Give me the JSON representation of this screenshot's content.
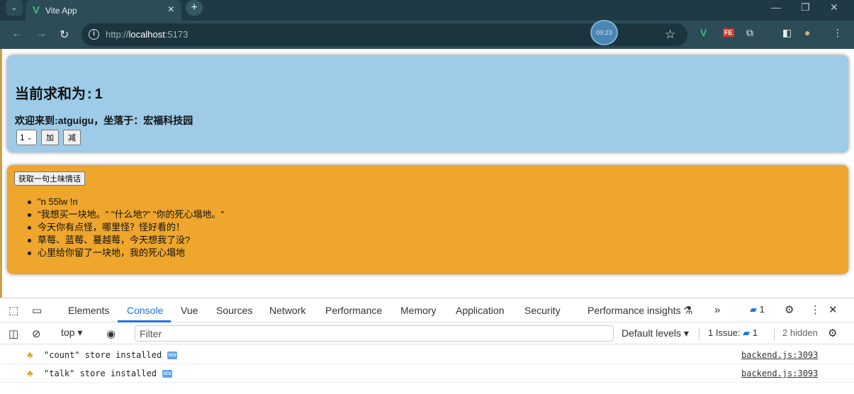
{
  "browser": {
    "tab_title": "Vite App",
    "url_scheme_host": "http://",
    "url_host": "localhost",
    "url_port": ":5173",
    "timer": "09:23"
  },
  "count_card": {
    "sum_label": "当前求和为",
    "sum_colon": ":",
    "sum_value": "1",
    "school_text": "欢迎来到:atguigu，坐落于：宏福科技园",
    "step_selected": "1",
    "add_label": "加",
    "minus_label": "减"
  },
  "talk_card": {
    "fetch_label": "获取一句土味情话",
    "items": [
      "\"n 55lw !n",
      "\"我想买一块地。\"  \"什么地?\"  \"你的死心塌地。\"",
      "今天你有点怪，哪里怪？怪好看的！",
      "草莓、蓝莓、蔓越莓，今天想我了没?",
      "心里给你留了一块地，我的死心塌地"
    ]
  },
  "devtools": {
    "tabs": [
      "Elements",
      "Console",
      "Vue",
      "Sources",
      "Network",
      "Performance",
      "Memory",
      "Application",
      "Security",
      "Performance insights"
    ],
    "active_tab": "Console",
    "context": "top",
    "filter_placeholder": "Filter",
    "levels": "Default levels",
    "issues_label": "1 Issue:",
    "issues_count": "1",
    "hidden": "2 hidden",
    "message_badge_count": "1",
    "logs": [
      {
        "text": "\"count\" store installed",
        "source": "backend.js:3093"
      },
      {
        "text": "\"talk\" store installed",
        "source": "backend.js:3093"
      }
    ]
  },
  "colors": {
    "count_card_bg": "#9dcbe8",
    "talk_card_bg": "#eea62c",
    "accent": "#1a73e8"
  }
}
